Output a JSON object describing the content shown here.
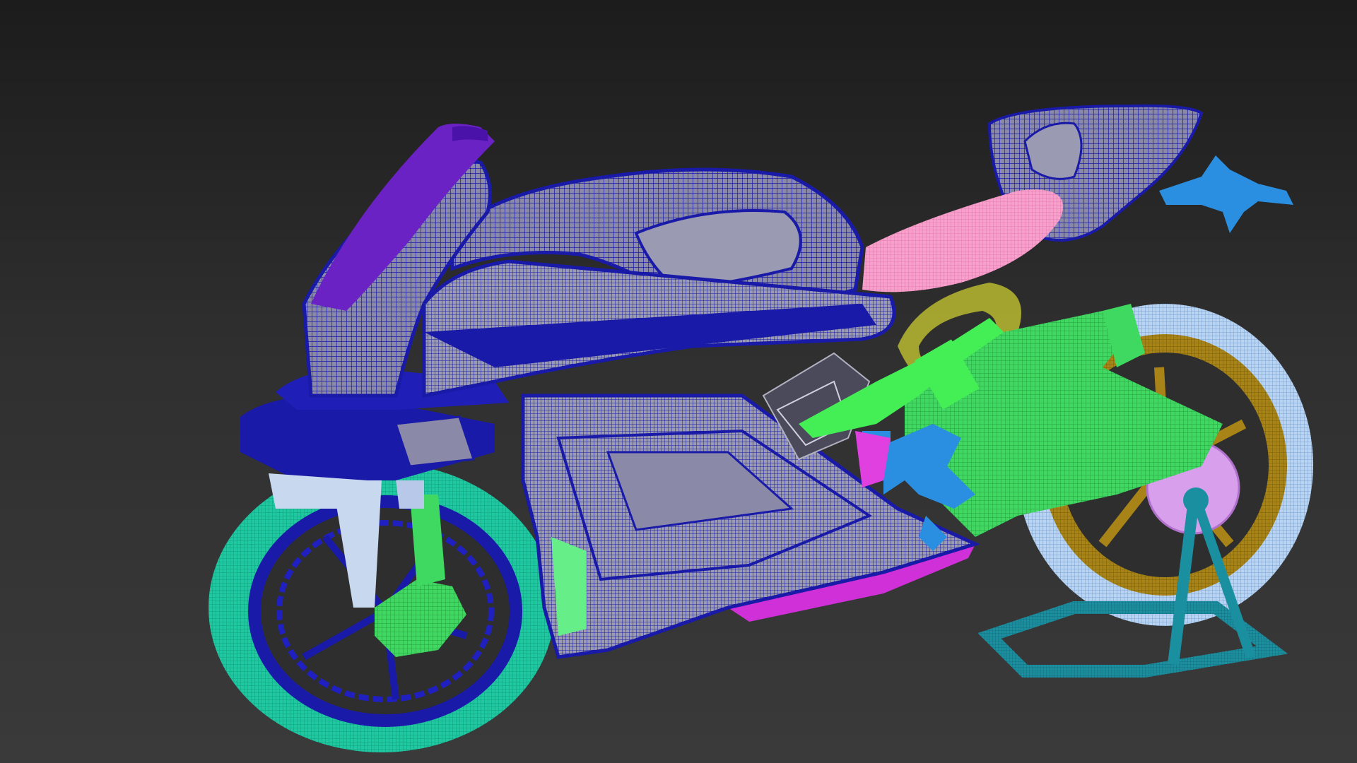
{
  "viewport": {
    "background_top": "#1c1c1c",
    "background_bottom": "#3a3a3a"
  },
  "parts": {
    "fairing": {
      "color": "#1a1aa8",
      "wire": "#8fa0c8"
    },
    "windscreen": {
      "color": "#6a22c4"
    },
    "front_tire": {
      "color": "#1fc8a0"
    },
    "front_rim": {
      "color": "#1a1aa8"
    },
    "front_fork": {
      "color": "#b8c8e8"
    },
    "front_brake": {
      "color": "#33dd55"
    },
    "rear_tire": {
      "color": "#a8c8ee"
    },
    "rear_rim": {
      "color": "#a07c10"
    },
    "swingarm": {
      "color": "#3fd860"
    },
    "seat": {
      "color": "#f28ac0"
    },
    "tail_light": {
      "color": "#2a8fe0"
    },
    "belly_pan": {
      "color": "#d030d8"
    },
    "stand": {
      "color": "#1a8fa0"
    },
    "sprocket": {
      "color": "#d8a0ec"
    },
    "clutch_lever": {
      "color": "#d0205a"
    },
    "inner_panel": {
      "color": "#e040e0"
    },
    "rear_fender": {
      "color": "#b8b830"
    },
    "footpeg": {
      "color": "#2a8fe0"
    }
  }
}
